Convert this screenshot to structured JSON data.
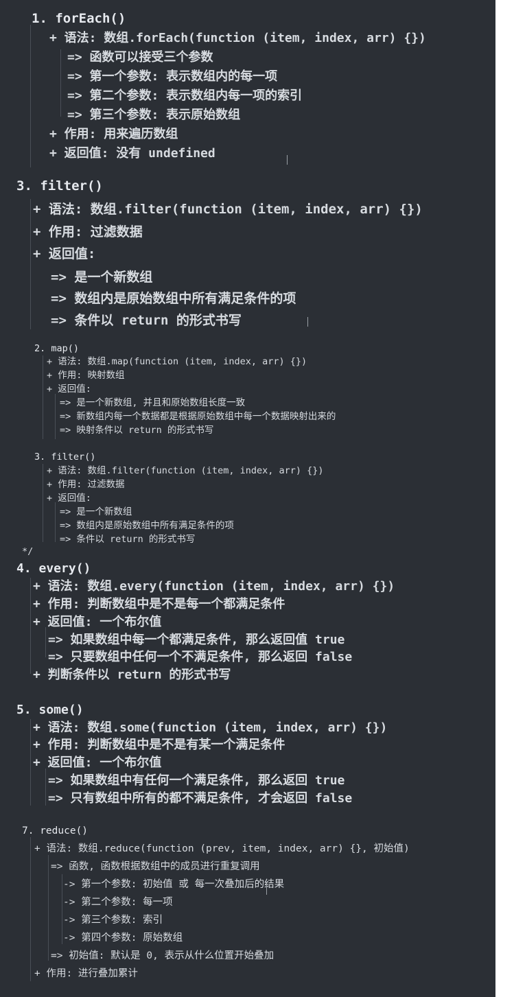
{
  "sections": {
    "foreach": {
      "title": "1. forEach()",
      "lines": [
        "+ 语法: 数组.forEach(function (item, index, arr) {})",
        "=> 函数可以接受三个参数",
        "=> 第一个参数: 表示数组内的每一项",
        "=> 第二个参数: 表示数组内每一项的索引",
        "=> 第三个参数: 表示原始数组",
        "+ 作用: 用来遍历数组",
        "+ 返回值: 没有 undefined"
      ]
    },
    "filter_large": {
      "title": "3. filter()",
      "lines": [
        "+ 语法: 数组.filter(function (item, index, arr) {})",
        "+ 作用: 过滤数据",
        "+ 返回值:",
        "=> 是一个新数组",
        "=> 数组内是原始数组中所有满足条件的项",
        "=> 条件以 return 的形式书写"
      ]
    },
    "map": {
      "title": "2. map()",
      "lines": [
        "+ 语法: 数组.map(function (item, index, arr) {})",
        "+ 作用: 映射数组",
        "+ 返回值:",
        "=> 是一个新数组, 并且和原始数组长度一致",
        "=> 新数组内每一个数据都是根据原始数组中每一个数据映射出来的",
        "=> 映射条件以 return 的形式书写"
      ]
    },
    "filter_small": {
      "title": "3. filter()",
      "lines": [
        "+ 语法: 数组.filter(function (item, index, arr) {})",
        "+ 作用: 过滤数据",
        "+ 返回值:",
        "=> 是一个新数组",
        "=> 数组内是原始数组中所有满足条件的项",
        "=> 条件以 return 的形式书写"
      ],
      "comment_end": "*/"
    },
    "every": {
      "title": "4. every()",
      "lines": [
        "+ 语法: 数组.every(function (item, index, arr) {})",
        "+ 作用: 判断数组中是不是每一个都满足条件",
        "+ 返回值: 一个布尔值",
        "=> 如果数组中每一个都满足条件, 那么返回值 true",
        "=> 只要数组中任何一个不满足条件, 那么返回 false",
        "+ 判断条件以 return 的形式书写"
      ]
    },
    "some": {
      "title": "5. some()",
      "lines": [
        "+ 语法: 数组.some(function (item, index, arr) {})",
        "+ 作用: 判断数组中是不是有某一个满足条件",
        "+ 返回值: 一个布尔值",
        "=> 如果数组中有任何一个满足条件, 那么返回 true",
        "=> 只有数组中所有的都不满足条件, 才会返回 false"
      ]
    },
    "reduce": {
      "title": "7. reduce()",
      "lines": [
        "+ 语法: 数组.reduce(function (prev, item, index, arr) {}, 初始值)",
        "=> 函数, 函数根据数组中的成员进行重复调用",
        "-> 第一个参数: 初始值 或 每一次叠加后的结果",
        "-> 第二个参数: 每一项",
        "-> 第三个参数: 索引",
        "-> 第四个参数: 原始数组",
        "=> 初始值: 默认是 0, 表示从什么位置开始叠加",
        "+ 作用: 进行叠加累计"
      ]
    }
  },
  "colors": {
    "background": "#2b2f35",
    "text": "#d7dbe0",
    "guide": "#4a4f57"
  }
}
